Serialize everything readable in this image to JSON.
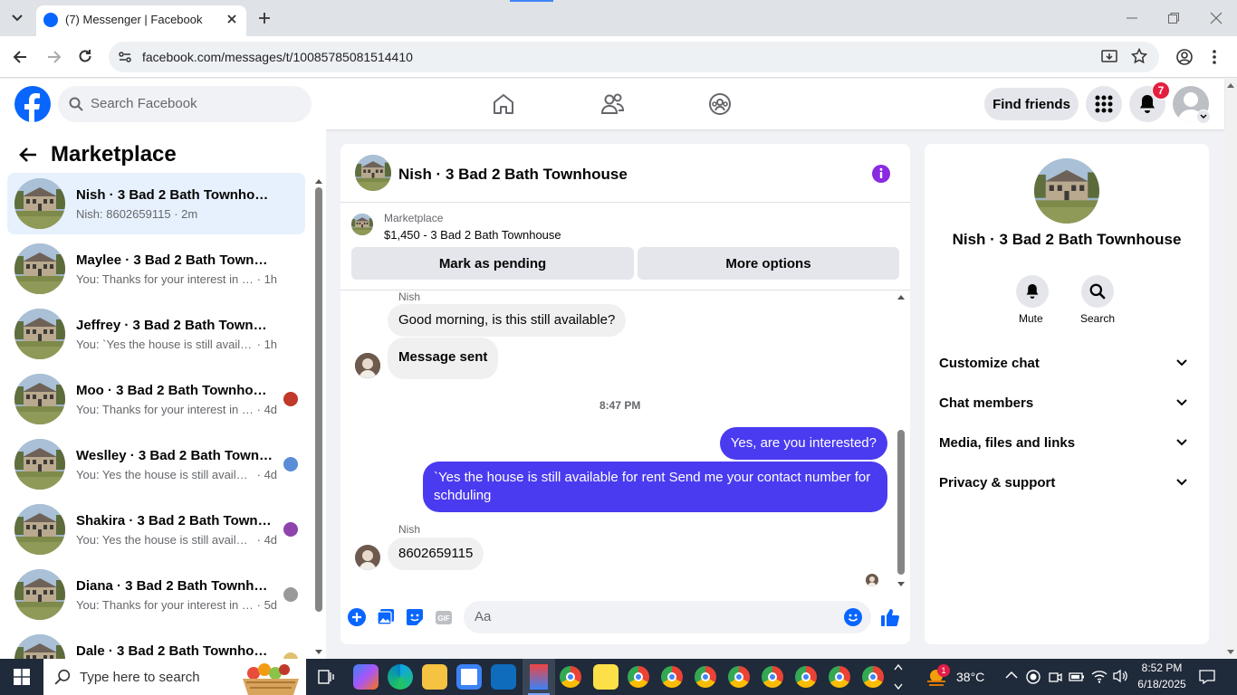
{
  "browser": {
    "tab_title": "(7) Messenger | Facebook",
    "url": "facebook.com/messages/t/10085785081514410"
  },
  "fb_header": {
    "search_placeholder": "Search Facebook",
    "find_friends": "Find friends",
    "notification_count": "7"
  },
  "sidebar": {
    "title": "Marketplace",
    "conversations": [
      {
        "name": "Nish · 3 Bad 2 Bath Townhouse",
        "preview": "Nish: 8602659115",
        "time": "2m",
        "selected": true
      },
      {
        "name": "Maylee · 3 Bad 2 Bath Townhouse",
        "preview": "You: Thanks for your interest in the ...",
        "time": "1h"
      },
      {
        "name": "Jeffrey · 3 Bad 2 Bath Townhouse",
        "preview": "You: `Yes the house is still available ...",
        "time": "1h"
      },
      {
        "name": "Moo · 3 Bad 2 Bath Townhouse",
        "preview": "You: Thanks for your interest in t...",
        "time": "4d"
      },
      {
        "name": "Weslley · 3 Bad 2 Bath Townh...",
        "preview": "You: Yes the house is still availab...",
        "time": "4d"
      },
      {
        "name": "Shakira · 3 Bad 2 Bath Townh...",
        "preview": "You: Yes the house is still availab...",
        "time": "4d"
      },
      {
        "name": "Diana · 3 Bad 2 Bath Townhou...",
        "preview": "You: Thanks for your interest in t...",
        "time": "5d"
      },
      {
        "name": "Dale · 3 Bad 2 Bath Townhouse",
        "preview": "",
        "time": ""
      }
    ]
  },
  "chat": {
    "title": "Nish · 3 Bad 2 Bath Townhouse",
    "listing_source": "Marketplace",
    "listing_title": "$1,450 - 3 Bad 2 Bath Townhouse",
    "mark_pending": "Mark as pending",
    "more_options": "More options",
    "messages": [
      {
        "sender": "Nish",
        "text": "Good morning, is this still available?"
      },
      {
        "sender": "",
        "text": "Message sent"
      },
      {
        "timestamp": "8:47 PM"
      },
      {
        "sender": "me",
        "text": "Yes, are you interested?"
      },
      {
        "sender": "me",
        "text": "`Yes the house is still available for rent Send me your contact number for schduling"
      },
      {
        "sender": "Nish",
        "text": "8602659115"
      }
    ],
    "input_placeholder": "Aa"
  },
  "info_panel": {
    "name": "Nish · 3 Bad 2 Bath Townhouse",
    "mute": "Mute",
    "search": "Search",
    "sections": [
      "Customize chat",
      "Chat members",
      "Media, files and links",
      "Privacy & support"
    ]
  },
  "taskbar": {
    "search_placeholder": "Type here to search",
    "temperature": "38°C",
    "time": "8:52 PM",
    "date": "6/18/2025",
    "weather_badge": "1"
  },
  "colors": {
    "fb_blue": "#0866ff",
    "outgoing_bubble": "#4a3bf0",
    "messenger_purple": "#8a2be2",
    "notif_red": "#e41e3f"
  }
}
